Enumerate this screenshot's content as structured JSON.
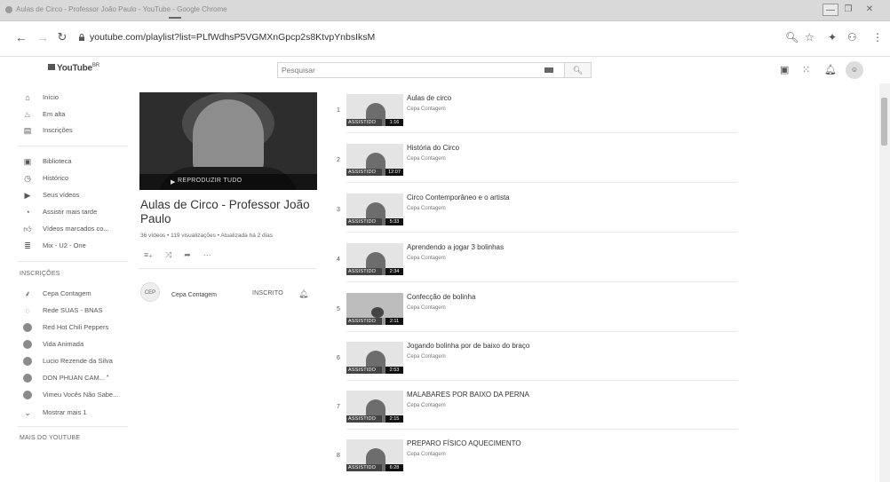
{
  "browser": {
    "window_title": "Aulas de Circo - Professor João Paulo - YouTube - Google Chrome",
    "url": "youtube.com/playlist?list=PLfWdhsP5VGMXnGpcp2s8KtvpYnbsIksM",
    "window_controls": {
      "minimize": "—",
      "maximize": "❐",
      "close": "✕"
    }
  },
  "masthead": {
    "logo_text": "YouTube",
    "logo_sup": "BR",
    "search_placeholder": "Pesquisar"
  },
  "sidebar": {
    "items": [
      {
        "label": "Início",
        "icon": "home-icon"
      },
      {
        "label": "Em alta",
        "icon": "trending-icon"
      },
      {
        "label": "Inscrições",
        "icon": "subscriptions-icon"
      },
      {
        "label": "Biblioteca",
        "icon": "library-icon"
      },
      {
        "label": "Histórico",
        "icon": "history-icon"
      },
      {
        "label": "Seus vídeos",
        "icon": "your-videos-icon"
      },
      {
        "label": "Assistir mais tarde",
        "icon": "watch-later-icon"
      },
      {
        "label": "Vídeos marcados co...",
        "icon": "liked-icon"
      },
      {
        "label": "Mix - U2 - One",
        "icon": "playlist-icon"
      }
    ],
    "subscriptions_heading": "INSCRIÇÕES",
    "subscriptions": [
      {
        "label": "Cepa Contagem"
      },
      {
        "label": "Rede SUAS - BNAS"
      },
      {
        "label": "Red Hot Chili Peppers"
      },
      {
        "label": "Vida Animada"
      },
      {
        "label": "Lucio Rezende da Silva"
      },
      {
        "label": "DON PHUAN CAM...",
        "dot": "•"
      },
      {
        "label": "Vimeu Vocês Não Sabe..."
      }
    ],
    "show_more": "Mostrar mais 1",
    "more_heading": "MAIS DO YOUTUBE"
  },
  "playlist": {
    "play_all": "REPRODUZIR TUDO",
    "title": "Aulas de Circo - Professor João Paulo",
    "meta": "36 vídeos • 119 visualizações • Atualizada há 2 dias",
    "actions": [
      "≡₊",
      "⤨",
      "➦",
      "⋯"
    ],
    "owner_initials": "CEP",
    "owner_name": "Cepa Contagem",
    "subscribe_label": "INSCRITO"
  },
  "videos": [
    {
      "index": "1",
      "title": "Aulas de circo",
      "channel": "Cepa Contagem",
      "watched": "ASSISTIDO",
      "duration": "1:16"
    },
    {
      "index": "2",
      "title": "História do Circo",
      "channel": "Cepa Contagem",
      "watched": "ASSISTIDO",
      "duration": "12:07"
    },
    {
      "index": "3",
      "title": "Circo Contemporâneo e o artista",
      "channel": "Cepa Contagem",
      "watched": "ASSISTIDO",
      "duration": "5:33"
    },
    {
      "index": "4",
      "title": "Aprendendo a jogar 3 bolinhas",
      "channel": "Cepa Contagem",
      "watched": "ASSISTIDO",
      "duration": "2:34"
    },
    {
      "index": "5",
      "title": "Confecção de bolinha",
      "channel": "Cepa Contagem",
      "watched": "ASSISTIDO",
      "duration": "2:11"
    },
    {
      "index": "6",
      "title": "Jogando bolinha por de baixo do braço",
      "channel": "Cepa Contagem",
      "watched": "ASSISTIDO",
      "duration": "2:53"
    },
    {
      "index": "7",
      "title": "MALABARES POR BAIXO DA PERNA",
      "channel": "Cepa Contagem",
      "watched": "ASSISTIDO",
      "duration": "2:15"
    },
    {
      "index": "8",
      "title": "PREPARO FÍSICO AQUECIMENTO",
      "channel": "Cepa Contagem",
      "watched": "ASSISTIDO",
      "duration": "6:28"
    }
  ]
}
